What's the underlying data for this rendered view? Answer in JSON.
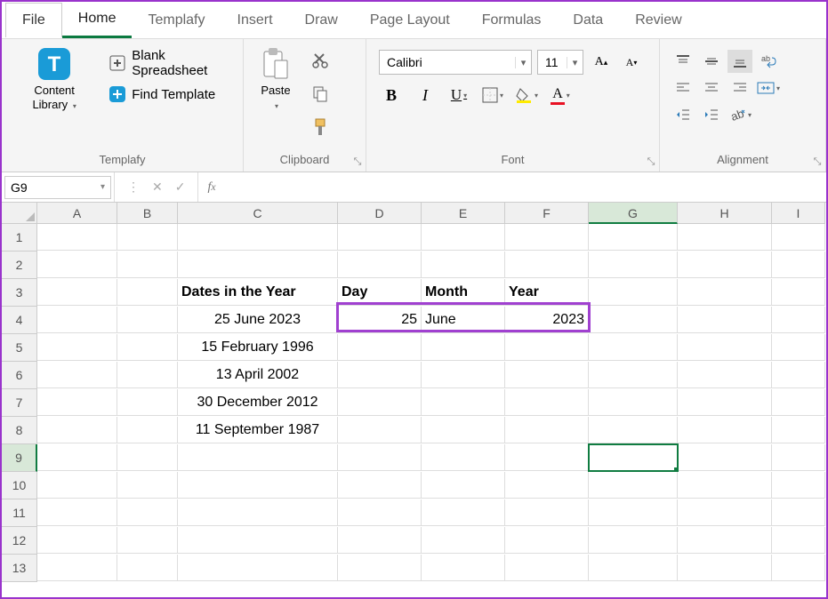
{
  "tabs": [
    "File",
    "Home",
    "Templafy",
    "Insert",
    "Draw",
    "Page Layout",
    "Formulas",
    "Data",
    "Review"
  ],
  "active_tab": "Home",
  "ribbon": {
    "templafy": {
      "content_library": "Content\nLibrary",
      "blank": "Blank Spreadsheet",
      "find": "Find Template",
      "label": "Templafy"
    },
    "clipboard": {
      "paste": "Paste",
      "label": "Clipboard"
    },
    "font": {
      "name": "Calibri",
      "size": "11",
      "label": "Font"
    },
    "alignment": {
      "label": "Alignment"
    }
  },
  "namebox": "G9",
  "formula": "",
  "columns": [
    "A",
    "B",
    "C",
    "D",
    "E",
    "F",
    "G",
    "H",
    "I"
  ],
  "col_classes": [
    "wA",
    "wB",
    "wC",
    "wD",
    "wE",
    "wF",
    "wG",
    "wH",
    "wI"
  ],
  "rows": 13,
  "active_cell": {
    "row": 9,
    "col": "G"
  },
  "highlight": {
    "row": 4,
    "cols": [
      "D",
      "E",
      "F"
    ]
  },
  "cells": {
    "C3": {
      "v": "Dates in the Year",
      "bold": true
    },
    "D3": {
      "v": "Day",
      "bold": true
    },
    "E3": {
      "v": "Month",
      "bold": true
    },
    "F3": {
      "v": "Year",
      "bold": true
    },
    "C4": {
      "v": "25 June 2023",
      "align": "center"
    },
    "D4": {
      "v": "25",
      "align": "right"
    },
    "E4": {
      "v": "June"
    },
    "F4": {
      "v": "2023",
      "align": "right"
    },
    "C5": {
      "v": "15 February 1996",
      "align": "center"
    },
    "C6": {
      "v": "13 April 2002",
      "align": "center"
    },
    "C7": {
      "v": "30 December 2012",
      "align": "center"
    },
    "C8": {
      "v": "11 September 1987",
      "align": "center"
    }
  }
}
